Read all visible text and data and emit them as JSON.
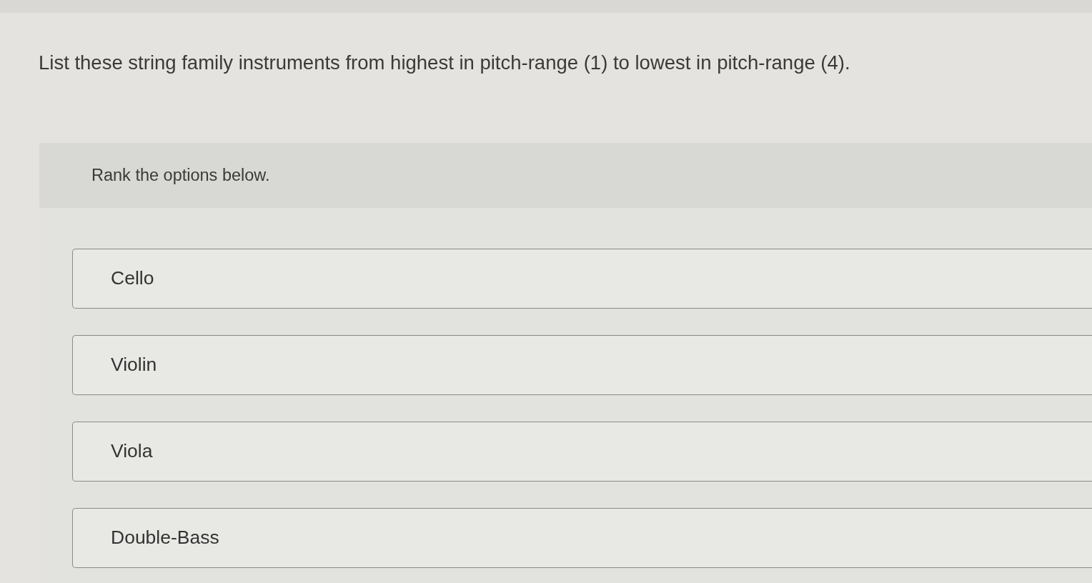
{
  "question": "List these string family instruments from highest in pitch-range (1) to lowest in pitch-range (4).",
  "instructions": "Rank the options below.",
  "options": [
    {
      "label": "Cello"
    },
    {
      "label": "Violin"
    },
    {
      "label": "Viola"
    },
    {
      "label": "Double-Bass"
    }
  ]
}
